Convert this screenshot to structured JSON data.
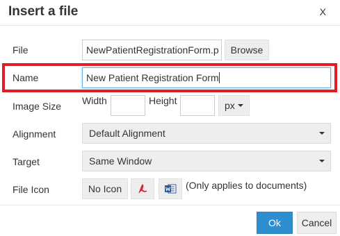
{
  "dialog": {
    "title": "Insert a file",
    "close_label": "X"
  },
  "fields": {
    "file": {
      "label": "File",
      "value": "NewPatientRegistrationForm.p",
      "browse_label": "Browse"
    },
    "name": {
      "label": "Name",
      "value": "New Patient Registration Form"
    },
    "image_size": {
      "label": "Image Size",
      "width_label": "Width",
      "height_label": "Height",
      "width_value": "",
      "height_value": "",
      "unit": "px"
    },
    "alignment": {
      "label": "Alignment",
      "selected": "Default Alignment"
    },
    "target": {
      "label": "Target",
      "selected": "Same Window"
    },
    "file_icon": {
      "label": "File Icon",
      "no_icon_label": "No Icon",
      "pdf_icon": "pdf-icon",
      "word_icon": "word-icon",
      "note": "(Only applies to documents)"
    }
  },
  "footer": {
    "ok_label": "Ok",
    "cancel_label": "Cancel"
  },
  "colors": {
    "highlight": "#e11d26",
    "primary": "#2d8fcf",
    "pdf": "#d9232d",
    "word": "#2b579a"
  }
}
